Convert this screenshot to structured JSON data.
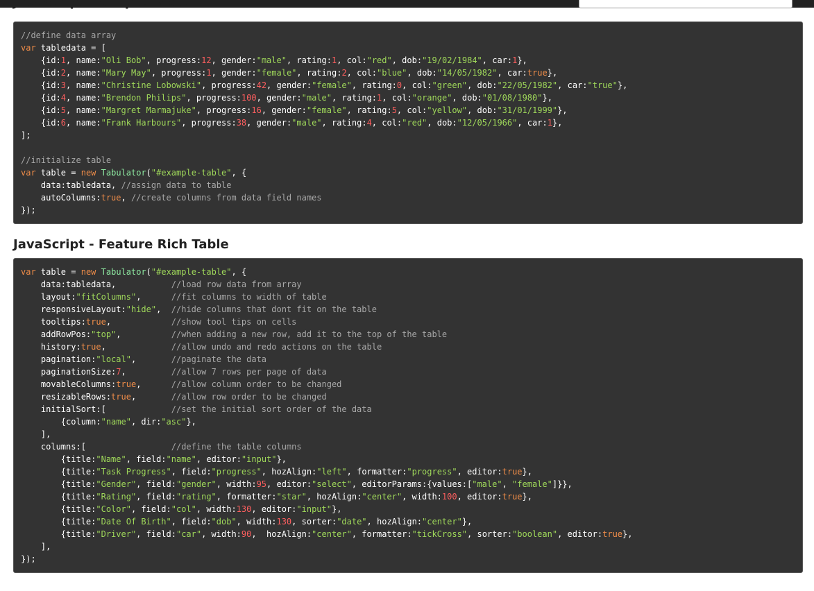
{
  "header": {
    "simple_title": "JavaScript - Simple Table",
    "rich_title": "JavaScript - Feature Rich Table"
  },
  "colors": {
    "code_background": "#333333",
    "keyword": "#f08d49",
    "string": "#9fd85a",
    "number": "#ff5f5f",
    "comment": "#a8a8a8",
    "function": "#8ee9a1",
    "plain": "#ffffff"
  },
  "code_simple": [
    [
      [
        "com",
        "//define data array"
      ]
    ],
    [
      [
        "kw",
        "var"
      ],
      [
        "p",
        " tabledata = ["
      ]
    ],
    [
      [
        "p",
        "    {id:"
      ],
      [
        "num",
        "1"
      ],
      [
        "p",
        ", name:"
      ],
      [
        "str",
        "\"Oli Bob\""
      ],
      [
        "p",
        ", progress:"
      ],
      [
        "num",
        "12"
      ],
      [
        "p",
        ", gender:"
      ],
      [
        "str",
        "\"male\""
      ],
      [
        "p",
        ", rating:"
      ],
      [
        "num",
        "1"
      ],
      [
        "p",
        ", col:"
      ],
      [
        "str",
        "\"red\""
      ],
      [
        "p",
        ", dob:"
      ],
      [
        "str",
        "\"19/02/1984\""
      ],
      [
        "p",
        ", car:"
      ],
      [
        "num",
        "1"
      ],
      [
        "p",
        "},"
      ]
    ],
    [
      [
        "p",
        "    {id:"
      ],
      [
        "num",
        "2"
      ],
      [
        "p",
        ", name:"
      ],
      [
        "str",
        "\"Mary May\""
      ],
      [
        "p",
        ", progress:"
      ],
      [
        "num",
        "1"
      ],
      [
        "p",
        ", gender:"
      ],
      [
        "str",
        "\"female\""
      ],
      [
        "p",
        ", rating:"
      ],
      [
        "num",
        "2"
      ],
      [
        "p",
        ", col:"
      ],
      [
        "str",
        "\"blue\""
      ],
      [
        "p",
        ", dob:"
      ],
      [
        "str",
        "\"14/05/1982\""
      ],
      [
        "p",
        ", car:"
      ],
      [
        "kw",
        "true"
      ],
      [
        "p",
        "},"
      ]
    ],
    [
      [
        "p",
        "    {id:"
      ],
      [
        "num",
        "3"
      ],
      [
        "p",
        ", name:"
      ],
      [
        "str",
        "\"Christine Lobowski\""
      ],
      [
        "p",
        ", progress:"
      ],
      [
        "num",
        "42"
      ],
      [
        "p",
        ", gender:"
      ],
      [
        "str",
        "\"female\""
      ],
      [
        "p",
        ", rating:"
      ],
      [
        "num",
        "0"
      ],
      [
        "p",
        ", col:"
      ],
      [
        "str",
        "\"green\""
      ],
      [
        "p",
        ", dob:"
      ],
      [
        "str",
        "\"22/05/1982\""
      ],
      [
        "p",
        ", car:"
      ],
      [
        "str",
        "\"true\""
      ],
      [
        "p",
        "},"
      ]
    ],
    [
      [
        "p",
        "    {id:"
      ],
      [
        "num",
        "4"
      ],
      [
        "p",
        ", name:"
      ],
      [
        "str",
        "\"Brendon Philips\""
      ],
      [
        "p",
        ", progress:"
      ],
      [
        "num",
        "100"
      ],
      [
        "p",
        ", gender:"
      ],
      [
        "str",
        "\"male\""
      ],
      [
        "p",
        ", rating:"
      ],
      [
        "num",
        "1"
      ],
      [
        "p",
        ", col:"
      ],
      [
        "str",
        "\"orange\""
      ],
      [
        "p",
        ", dob:"
      ],
      [
        "str",
        "\"01/08/1980\""
      ],
      [
        "p",
        "},"
      ]
    ],
    [
      [
        "p",
        "    {id:"
      ],
      [
        "num",
        "5"
      ],
      [
        "p",
        ", name:"
      ],
      [
        "str",
        "\"Margret Marmajuke\""
      ],
      [
        "p",
        ", progress:"
      ],
      [
        "num",
        "16"
      ],
      [
        "p",
        ", gender:"
      ],
      [
        "str",
        "\"female\""
      ],
      [
        "p",
        ", rating:"
      ],
      [
        "num",
        "5"
      ],
      [
        "p",
        ", col:"
      ],
      [
        "str",
        "\"yellow\""
      ],
      [
        "p",
        ", dob:"
      ],
      [
        "str",
        "\"31/01/1999\""
      ],
      [
        "p",
        "},"
      ]
    ],
    [
      [
        "p",
        "    {id:"
      ],
      [
        "num",
        "6"
      ],
      [
        "p",
        ", name:"
      ],
      [
        "str",
        "\"Frank Harbours\""
      ],
      [
        "p",
        ", progress:"
      ],
      [
        "num",
        "38"
      ],
      [
        "p",
        ", gender:"
      ],
      [
        "str",
        "\"male\""
      ],
      [
        "p",
        ", rating:"
      ],
      [
        "num",
        "4"
      ],
      [
        "p",
        ", col:"
      ],
      [
        "str",
        "\"red\""
      ],
      [
        "p",
        ", dob:"
      ],
      [
        "str",
        "\"12/05/1966\""
      ],
      [
        "p",
        ", car:"
      ],
      [
        "num",
        "1"
      ],
      [
        "p",
        "},"
      ]
    ],
    [
      [
        "p",
        "];"
      ]
    ],
    [],
    [
      [
        "com",
        "//initialize table"
      ]
    ],
    [
      [
        "kw",
        "var"
      ],
      [
        "p",
        " table = "
      ],
      [
        "kw",
        "new"
      ],
      [
        "p",
        " "
      ],
      [
        "fn",
        "Tabulator"
      ],
      [
        "p",
        "("
      ],
      [
        "str",
        "\"#example-table\""
      ],
      [
        "p",
        ", {"
      ]
    ],
    [
      [
        "p",
        "    data:tabledata, "
      ],
      [
        "com",
        "//assign data to table"
      ]
    ],
    [
      [
        "p",
        "    autoColumns:"
      ],
      [
        "kw",
        "true"
      ],
      [
        "p",
        ", "
      ],
      [
        "com",
        "//create columns from data field names"
      ]
    ],
    [
      [
        "p",
        "});"
      ]
    ]
  ],
  "code_rich": [
    [
      [
        "kw",
        "var"
      ],
      [
        "p",
        " table = "
      ],
      [
        "kw",
        "new"
      ],
      [
        "p",
        " "
      ],
      [
        "fn",
        "Tabulator"
      ],
      [
        "p",
        "("
      ],
      [
        "str",
        "\"#example-table\""
      ],
      [
        "p",
        ", {"
      ]
    ],
    [
      [
        "p",
        "    data:tabledata,           "
      ],
      [
        "com",
        "//load row data from array"
      ]
    ],
    [
      [
        "p",
        "    layout:"
      ],
      [
        "str",
        "\"fitColumns\""
      ],
      [
        "p",
        ",      "
      ],
      [
        "com",
        "//fit columns to width of table"
      ]
    ],
    [
      [
        "p",
        "    responsiveLayout:"
      ],
      [
        "str",
        "\"hide\""
      ],
      [
        "p",
        ",  "
      ],
      [
        "com",
        "//hide columns that dont fit on the table"
      ]
    ],
    [
      [
        "p",
        "    tooltips:"
      ],
      [
        "kw",
        "true"
      ],
      [
        "p",
        ",            "
      ],
      [
        "com",
        "//show tool tips on cells"
      ]
    ],
    [
      [
        "p",
        "    addRowPos:"
      ],
      [
        "str",
        "\"top\""
      ],
      [
        "p",
        ",          "
      ],
      [
        "com",
        "//when adding a new row, add it to the top of the table"
      ]
    ],
    [
      [
        "p",
        "    history:"
      ],
      [
        "kw",
        "true"
      ],
      [
        "p",
        ",             "
      ],
      [
        "com",
        "//allow undo and redo actions on the table"
      ]
    ],
    [
      [
        "p",
        "    pagination:"
      ],
      [
        "str",
        "\"local\""
      ],
      [
        "p",
        ",       "
      ],
      [
        "com",
        "//paginate the data"
      ]
    ],
    [
      [
        "p",
        "    paginationSize:"
      ],
      [
        "num",
        "7"
      ],
      [
        "p",
        ",         "
      ],
      [
        "com",
        "//allow 7 rows per page of data"
      ]
    ],
    [
      [
        "p",
        "    movableColumns:"
      ],
      [
        "kw",
        "true"
      ],
      [
        "p",
        ",      "
      ],
      [
        "com",
        "//allow column order to be changed"
      ]
    ],
    [
      [
        "p",
        "    resizableRows:"
      ],
      [
        "kw",
        "true"
      ],
      [
        "p",
        ",       "
      ],
      [
        "com",
        "//allow row order to be changed"
      ]
    ],
    [
      [
        "p",
        "    initialSort:[             "
      ],
      [
        "com",
        "//set the initial sort order of the data"
      ]
    ],
    [
      [
        "p",
        "        {column:"
      ],
      [
        "str",
        "\"name\""
      ],
      [
        "p",
        ", dir:"
      ],
      [
        "str",
        "\"asc\""
      ],
      [
        "p",
        "},"
      ]
    ],
    [
      [
        "p",
        "    ],"
      ]
    ],
    [
      [
        "p",
        "    columns:[                 "
      ],
      [
        "com",
        "//define the table columns"
      ]
    ],
    [
      [
        "p",
        "        {title:"
      ],
      [
        "str",
        "\"Name\""
      ],
      [
        "p",
        ", field:"
      ],
      [
        "str",
        "\"name\""
      ],
      [
        "p",
        ", editor:"
      ],
      [
        "str",
        "\"input\""
      ],
      [
        "p",
        "},"
      ]
    ],
    [
      [
        "p",
        "        {title:"
      ],
      [
        "str",
        "\"Task Progress\""
      ],
      [
        "p",
        ", field:"
      ],
      [
        "str",
        "\"progress\""
      ],
      [
        "p",
        ", hozAlign:"
      ],
      [
        "str",
        "\"left\""
      ],
      [
        "p",
        ", formatter:"
      ],
      [
        "str",
        "\"progress\""
      ],
      [
        "p",
        ", editor:"
      ],
      [
        "kw",
        "true"
      ],
      [
        "p",
        "},"
      ]
    ],
    [
      [
        "p",
        "        {title:"
      ],
      [
        "str",
        "\"Gender\""
      ],
      [
        "p",
        ", field:"
      ],
      [
        "str",
        "\"gender\""
      ],
      [
        "p",
        ", width:"
      ],
      [
        "num",
        "95"
      ],
      [
        "p",
        ", editor:"
      ],
      [
        "str",
        "\"select\""
      ],
      [
        "p",
        ", editorParams:{values:["
      ],
      [
        "str",
        "\"male\""
      ],
      [
        "p",
        ", "
      ],
      [
        "str",
        "\"female\""
      ],
      [
        "p",
        "]}},"
      ]
    ],
    [
      [
        "p",
        "        {title:"
      ],
      [
        "str",
        "\"Rating\""
      ],
      [
        "p",
        ", field:"
      ],
      [
        "str",
        "\"rating\""
      ],
      [
        "p",
        ", formatter:"
      ],
      [
        "str",
        "\"star\""
      ],
      [
        "p",
        ", hozAlign:"
      ],
      [
        "str",
        "\"center\""
      ],
      [
        "p",
        ", width:"
      ],
      [
        "num",
        "100"
      ],
      [
        "p",
        ", editor:"
      ],
      [
        "kw",
        "true"
      ],
      [
        "p",
        "},"
      ]
    ],
    [
      [
        "p",
        "        {title:"
      ],
      [
        "str",
        "\"Color\""
      ],
      [
        "p",
        ", field:"
      ],
      [
        "str",
        "\"col\""
      ],
      [
        "p",
        ", width:"
      ],
      [
        "num",
        "130"
      ],
      [
        "p",
        ", editor:"
      ],
      [
        "str",
        "\"input\""
      ],
      [
        "p",
        "},"
      ]
    ],
    [
      [
        "p",
        "        {title:"
      ],
      [
        "str",
        "\"Date Of Birth\""
      ],
      [
        "p",
        ", field:"
      ],
      [
        "str",
        "\"dob\""
      ],
      [
        "p",
        ", width:"
      ],
      [
        "num",
        "130"
      ],
      [
        "p",
        ", sorter:"
      ],
      [
        "str",
        "\"date\""
      ],
      [
        "p",
        ", hozAlign:"
      ],
      [
        "str",
        "\"center\""
      ],
      [
        "p",
        "},"
      ]
    ],
    [
      [
        "p",
        "        {title:"
      ],
      [
        "str",
        "\"Driver\""
      ],
      [
        "p",
        ", field:"
      ],
      [
        "str",
        "\"car\""
      ],
      [
        "p",
        ", width:"
      ],
      [
        "num",
        "90"
      ],
      [
        "p",
        ",  hozAlign:"
      ],
      [
        "str",
        "\"center\""
      ],
      [
        "p",
        ", formatter:"
      ],
      [
        "str",
        "\"tickCross\""
      ],
      [
        "p",
        ", sorter:"
      ],
      [
        "str",
        "\"boolean\""
      ],
      [
        "p",
        ", editor:"
      ],
      [
        "kw",
        "true"
      ],
      [
        "p",
        "},"
      ]
    ],
    [
      [
        "p",
        "    ],"
      ]
    ],
    [
      [
        "p",
        "});"
      ]
    ]
  ]
}
